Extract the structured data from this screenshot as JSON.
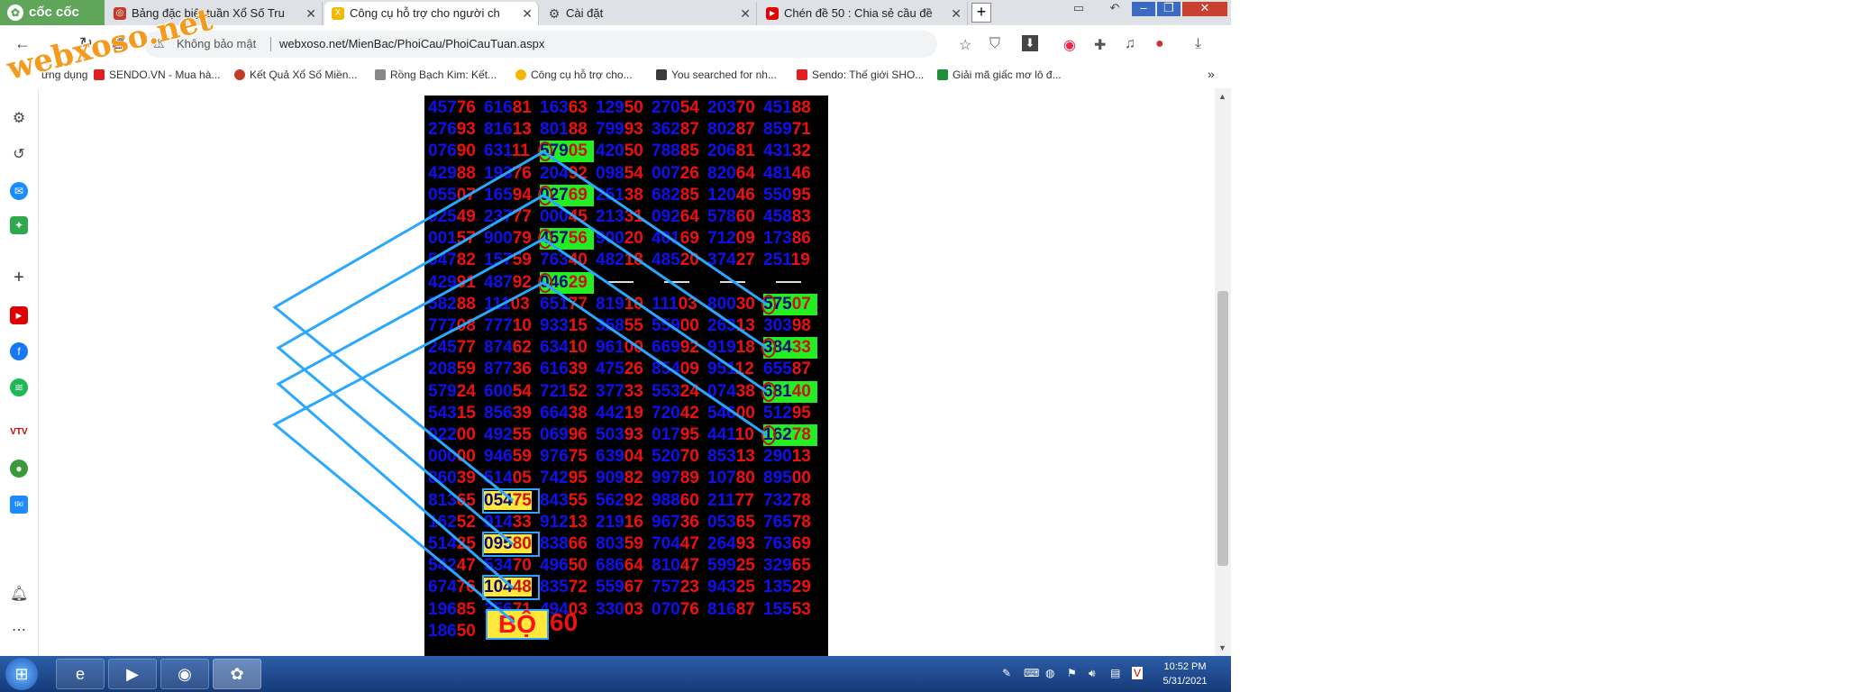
{
  "browser": {
    "name": "cốc cốc",
    "tabs": [
      {
        "title": "Bảng đặc biệt tuần Xổ Số Tru"
      },
      {
        "title": "Công cụ hỗ trợ cho người ch"
      },
      {
        "title": "Cài đặt"
      },
      {
        "title": "Chén đề 50 : Chia sẻ cầu đề"
      }
    ],
    "security_label": "Không bảo mật",
    "url": "webxoso.net/MienBac/PhoiCau/PhoiCauTuan.aspx",
    "watermark": "webxoso.net",
    "bookmarks": [
      {
        "label": "ứng dụng",
        "color": "#4285f4"
      },
      {
        "label": "SENDO.VN - Mua hà...",
        "color": "#e02020"
      },
      {
        "label": "Kết Quả Xổ Số Miền...",
        "color": "#c23b2a"
      },
      {
        "label": "Rồng Bạch Kim: Kết...",
        "color": "#888888"
      },
      {
        "label": "Công cụ hỗ trợ cho...",
        "color": "#f5b800"
      },
      {
        "label": "You searched for nh...",
        "color": "#3a3a3a"
      },
      {
        "label": "Sendo: Thế giới SHO...",
        "color": "#e02020"
      },
      {
        "label": "Giải mã giấc mơ lô đ...",
        "color": "#1f8f3a"
      }
    ]
  },
  "board": {
    "rows": [
      [
        "45776",
        "61681",
        "16363",
        "12950",
        "27054",
        "20370",
        "45188"
      ],
      [
        "27693",
        "81613",
        "80188",
        "79993",
        "36287",
        "80287",
        "85971"
      ],
      [
        "07690",
        "63111",
        "57905",
        "42050",
        "78885",
        "20681",
        "43132"
      ],
      [
        "42988",
        "19376",
        "20492",
        "09854",
        "00726",
        "82064",
        "48146"
      ],
      [
        "05507",
        "16594",
        "02769",
        "25138",
        "68285",
        "12046",
        "55095"
      ],
      [
        "92549",
        "23777",
        "00045",
        "21331",
        "09264",
        "57860",
        "45883"
      ],
      [
        "00157",
        "90079",
        "45756",
        "90020",
        "40169",
        "71209",
        "17386"
      ],
      [
        "54782",
        "15759",
        "76340",
        "48218",
        "48520",
        "37427",
        "25119"
      ],
      [
        "42991",
        "48792",
        "04629",
        "",
        "",
        "",
        ""
      ],
      [
        "58288",
        "11103",
        "65177",
        "81910",
        "11103",
        "80030",
        "57507"
      ],
      [
        "77708",
        "77710",
        "93315",
        "35855",
        "55900",
        "26313",
        "30398"
      ],
      [
        "24577",
        "87462",
        "63410",
        "96100",
        "66992",
        "91918",
        "38433"
      ],
      [
        "20859",
        "87736",
        "61639",
        "47526",
        "85409",
        "95112",
        "65587"
      ],
      [
        "57924",
        "60054",
        "72152",
        "37733",
        "55324",
        "07438",
        "68140"
      ],
      [
        "54315",
        "85639",
        "66438",
        "44219",
        "72042",
        "54600",
        "51295"
      ],
      [
        "02200",
        "49255",
        "06996",
        "50393",
        "01795",
        "44110",
        "16278"
      ],
      [
        "00000",
        "94659",
        "97675",
        "63904",
        "52070",
        "85313",
        "29013"
      ],
      [
        "86039",
        "51405",
        "74295",
        "90982",
        "99789",
        "10780",
        "89500"
      ],
      [
        "81365",
        "05475",
        "84355",
        "56292",
        "98860",
        "21177",
        "73278"
      ],
      [
        "16252",
        "91433",
        "91213",
        "21916",
        "96736",
        "05365",
        "76578"
      ],
      [
        "51425",
        "09580",
        "83866",
        "80359",
        "70447",
        "26493",
        "76369"
      ],
      [
        "54247",
        "53470",
        "49650",
        "68664",
        "81047",
        "59925",
        "32965"
      ],
      [
        "67476",
        "10448",
        "83572",
        "55967",
        "75723",
        "94325",
        "13529"
      ],
      [
        "19685",
        "35671",
        "49403",
        "33003",
        "07076",
        "81687",
        "15553"
      ],
      [
        "18650",
        "",
        "",
        "",
        "",
        "",
        ""
      ]
    ],
    "green_cells": [
      [
        2,
        2
      ],
      [
        4,
        2
      ],
      [
        6,
        2
      ],
      [
        8,
        2
      ],
      [
        9,
        6
      ],
      [
        11,
        6
      ],
      [
        13,
        6
      ],
      [
        15,
        6
      ]
    ],
    "yellow_cells": [
      [
        18,
        1
      ],
      [
        20,
        1
      ],
      [
        22,
        1
      ]
    ],
    "footer_label": "BỘ",
    "footer_value": "60"
  },
  "taskbar": {
    "time": "10:52 PM",
    "date": "5/31/2021"
  }
}
